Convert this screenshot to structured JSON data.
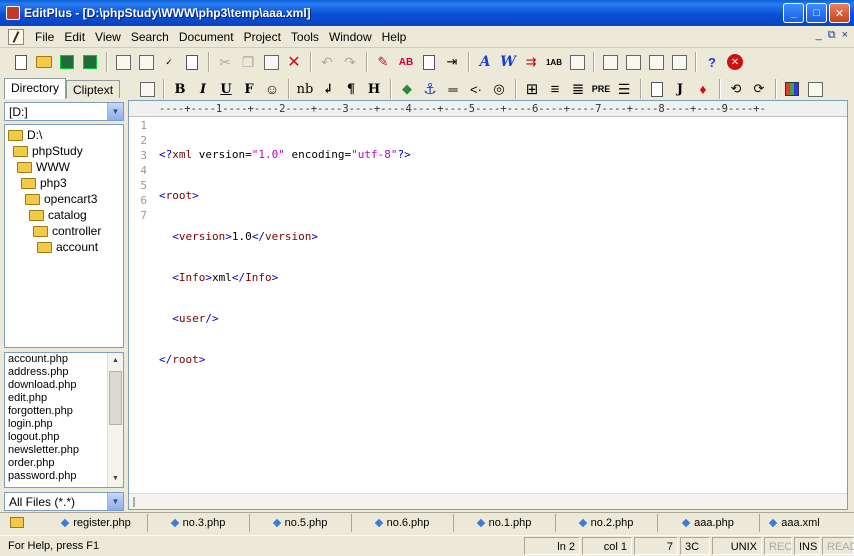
{
  "window": {
    "title": "EditPlus - [D:\\phpStudy\\WWW\\php3\\temp\\aaa.xml]",
    "controls": {
      "minimize": "_",
      "maximize": "□",
      "close": "✕"
    }
  },
  "menu": {
    "items": [
      "File",
      "Edit",
      "View",
      "Search",
      "Document",
      "Project",
      "Tools",
      "Window",
      "Help"
    ],
    "mdi_controls": [
      "_",
      "⧉",
      "×"
    ]
  },
  "toolbar2": {
    "bold": "B",
    "italic": "I",
    "underline": "U",
    "font": "F",
    "nbsp": "nb",
    "br": "↲",
    "para": "¶",
    "heading": "H",
    "pre": "PRE",
    "java": "J"
  },
  "sidebar": {
    "tabs": [
      "Directory",
      "Cliptext"
    ],
    "drive": "[D:]",
    "tree": [
      "D:\\",
      "phpStudy",
      "WWW",
      "php3",
      "opencart3",
      "catalog",
      "controller",
      "account"
    ],
    "files": [
      "account.php",
      "address.php",
      "download.php",
      "edit.php",
      "forgotten.php",
      "login.php",
      "logout.php",
      "newsletter.php",
      "order.php",
      "password.php"
    ],
    "filter": "All Files (*.*)"
  },
  "editor": {
    "ruler": "----+----1----+----2----+----3----+----4----+----5----+----6----+----7----+----8----+----9----+-",
    "line_numbers": [
      "1",
      "2",
      "3",
      "4",
      "5",
      "6",
      "7"
    ],
    "lines": [
      "<?xml version=\"1.0\" encoding=\"utf-8\"?>",
      "<root>",
      "  <version>1.0</version>",
      "  <Info>xml</Info>",
      "  <user/>",
      "</root>",
      ""
    ]
  },
  "document_tabs": [
    "register.php",
    "no.3.php",
    "no.5.php",
    "no.6.php",
    "no.1.php",
    "no.2.php",
    "aaa.php",
    "aaa.xml"
  ],
  "status": {
    "help": "For Help, press F1",
    "line": "ln 2",
    "col": "col 1",
    "chars": "7",
    "hex": "3C",
    "format": "UNIX",
    "rec": "REC",
    "ins": "INS",
    "read": "READ"
  }
}
